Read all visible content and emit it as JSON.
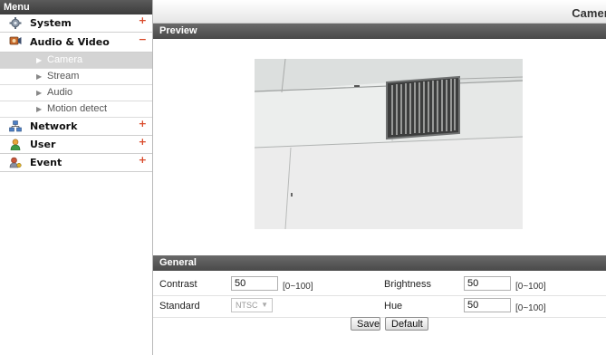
{
  "sidebar": {
    "header": "Menu",
    "categories": [
      {
        "label": "System",
        "toggle": "+"
      },
      {
        "label": "Audio & Video",
        "toggle": "−"
      },
      {
        "label": "Network",
        "toggle": "+"
      },
      {
        "label": "User",
        "toggle": "+"
      },
      {
        "label": "Event",
        "toggle": "+"
      }
    ],
    "sub_items": [
      {
        "label": "Camera",
        "active": true
      },
      {
        "label": "Stream"
      },
      {
        "label": "Audio"
      },
      {
        "label": "Motion detect"
      }
    ]
  },
  "page": {
    "title": "Camera"
  },
  "preview": {
    "section_label": "Preview"
  },
  "general": {
    "section_label": "General",
    "contrast": {
      "label": "Contrast",
      "value": "50",
      "range": "[0~100]"
    },
    "brightness": {
      "label": "Brightness",
      "value": "50",
      "range": "[0~100]"
    },
    "standard": {
      "label": "Standard",
      "value": "NTSC"
    },
    "hue": {
      "label": "Hue",
      "value": "50",
      "range": "[0~100]"
    }
  },
  "buttons": {
    "save": "Save",
    "default": "Default"
  },
  "colors": {
    "accent_toggle": "#d9492a",
    "section_bar": "#555555",
    "active_item": "#d4d4d4"
  }
}
